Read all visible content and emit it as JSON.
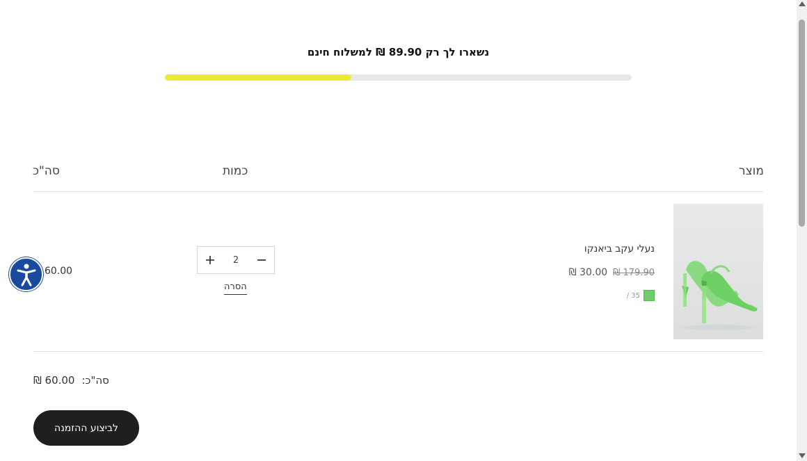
{
  "shipping_banner": {
    "message": "נשארו לך רק 89.90 ₪ למשלוח חינם",
    "progress_percent": 40,
    "progress_color": "#ece935"
  },
  "table_header": {
    "product": "מוצר",
    "quantity": "כמות",
    "total": "סה\"כ"
  },
  "cart_item": {
    "name": "נעלי עקב ביאנקו",
    "price_original": "179.90 ₪",
    "price_current": "30.00 ₪",
    "variant_text": "35 /",
    "swatch_color": "#6ecf6a",
    "quantity": "2",
    "remove_label": "הסרה",
    "line_total": "60.00",
    "image_icon": "green-heel-shoe-image"
  },
  "summary": {
    "label": "סה\"כ:",
    "value": "60.00 ₪"
  },
  "checkout": {
    "label": "לביצוע ההזמנה"
  },
  "icons": {
    "accessibility": "accessibility-icon",
    "plus": "plus-icon",
    "minus": "minus-icon"
  }
}
